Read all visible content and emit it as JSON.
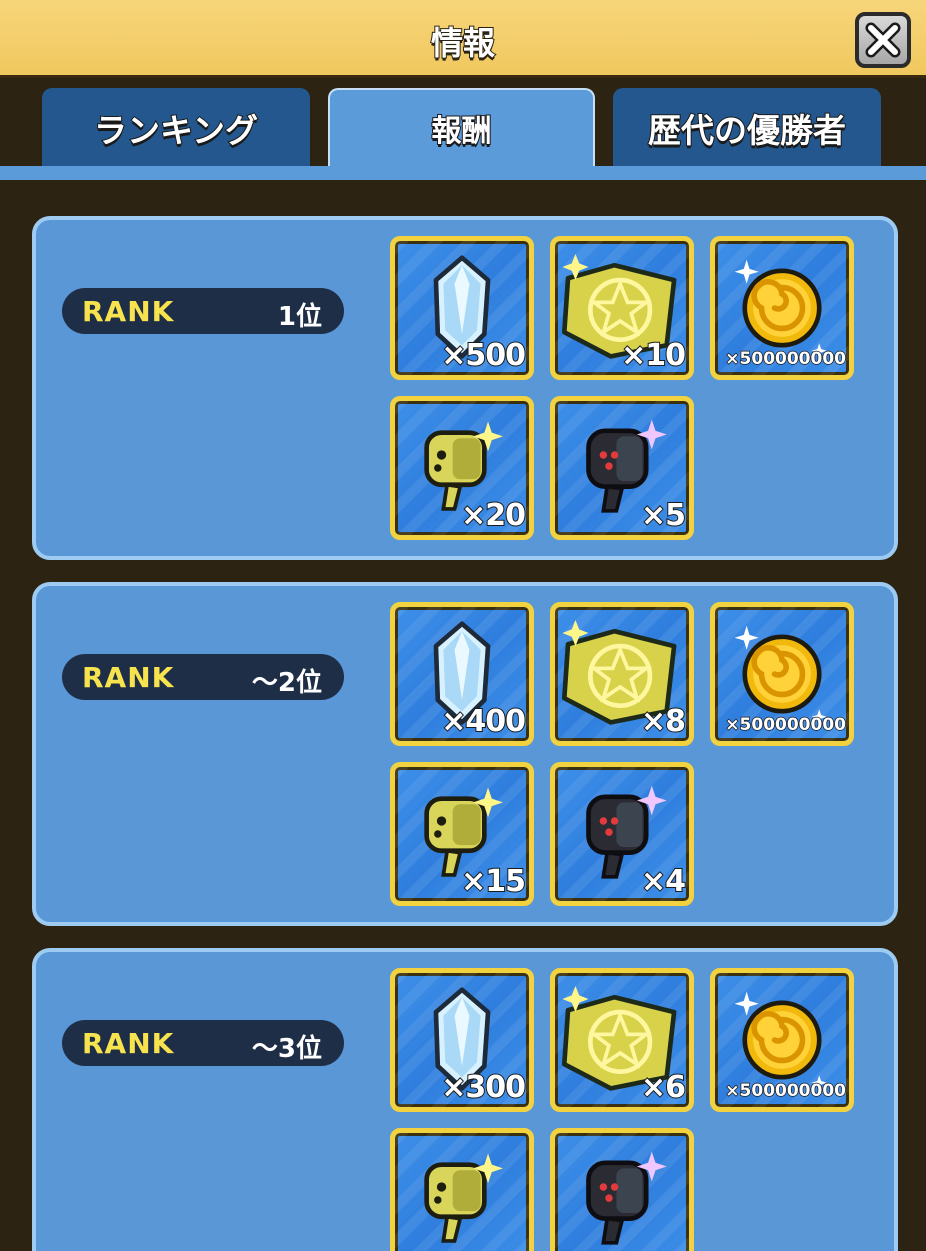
{
  "header": {
    "title": "情報"
  },
  "tabs": [
    {
      "label": "ランキング",
      "active": false
    },
    {
      "label": "報酬",
      "active": true
    },
    {
      "label": "歴代の優勝者",
      "active": false
    }
  ],
  "rank_label": "RANK",
  "rewards_tiers": [
    {
      "rank": "1位",
      "rewards": [
        "×500",
        "×10",
        "×500000000",
        "×20",
        "×5"
      ]
    },
    {
      "rank": "～2位",
      "rewards": [
        "×400",
        "×8",
        "×500000000",
        "×15",
        "×4"
      ]
    },
    {
      "rank": "～3位",
      "rewards": [
        "×300",
        "×6",
        "×500000000"
      ]
    }
  ],
  "reward_icons": [
    "crystal-icon",
    "magic-map-icon",
    "gold-coin-icon",
    "yellow-monster-icon",
    "black-monster-icon"
  ],
  "colors": {
    "header": "#f0c85e",
    "card": "#5a97d6",
    "frame": "#f2d23f",
    "rank_text": "#f7e34e",
    "tab_inactive": "#23578e",
    "tab_active": "#5b9bd9"
  }
}
